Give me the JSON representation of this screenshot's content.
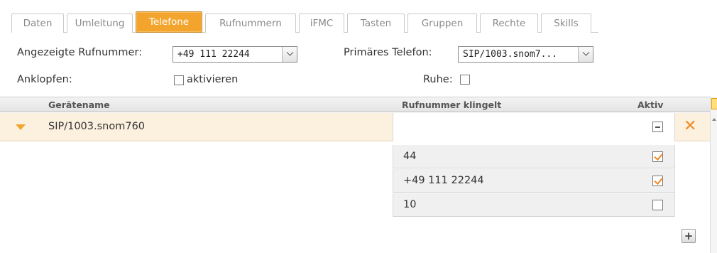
{
  "tabs": [
    {
      "label": "Daten"
    },
    {
      "label": "Umleitung"
    },
    {
      "label": "Telefone"
    },
    {
      "label": "Rufnummern"
    },
    {
      "label": "iFMC"
    },
    {
      "label": "Tasten"
    },
    {
      "label": "Gruppen"
    },
    {
      "label": "Rechte"
    },
    {
      "label": "Skills"
    }
  ],
  "active_tab": "Telefone",
  "form": {
    "displayed_number_label": "Angezeigte Rufnummer:",
    "displayed_number_value": "+49 111 22244",
    "primary_phone_label": "Primäres Telefon:",
    "primary_phone_value": "SIP/1003.snom7...",
    "call_waiting_label": "Anklopfen:",
    "call_waiting_option": "aktivieren",
    "dnd_label": "Ruhe:"
  },
  "table": {
    "col_device": "Gerätename",
    "col_ringing": "Rufnummer klingelt",
    "col_active": "Aktiv",
    "device": {
      "name": "SIP/1003.snom760"
    },
    "numbers": [
      {
        "number": "44",
        "checked": true
      },
      {
        "number": "+49 111 22244",
        "checked": true
      },
      {
        "number": "10",
        "checked": false
      }
    ]
  },
  "icons": [
    "expand-arrow-icon",
    "minus-icon",
    "close-icon",
    "plus-icon",
    "chevron-down-icon"
  ],
  "colors": {
    "accent": "#f2a42c",
    "row_highlight": "#fcf0de",
    "close": "#f08a24"
  }
}
